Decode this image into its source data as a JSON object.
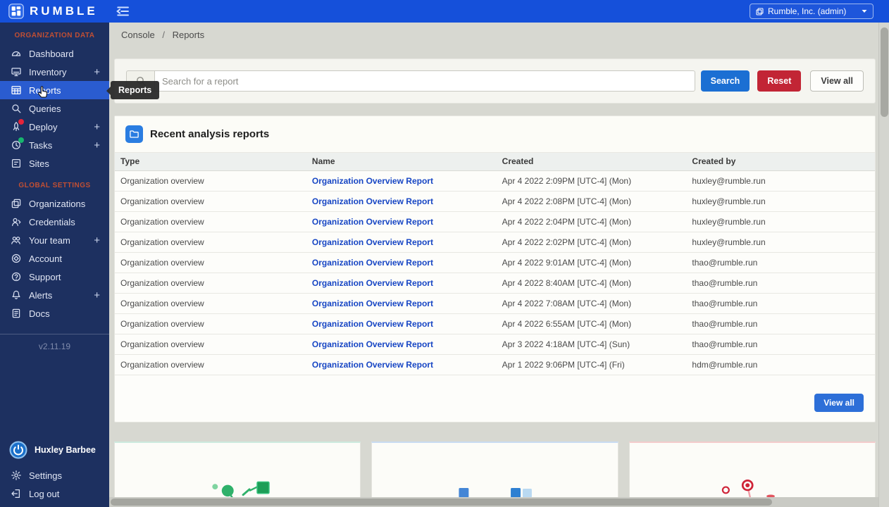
{
  "header": {
    "brand": "RUMBLE",
    "org_selector": "Rumble, Inc. (admin)"
  },
  "breadcrumb": {
    "parent": "Console",
    "separator": "/",
    "current": "Reports"
  },
  "tooltip": {
    "label": "Reports"
  },
  "search_panel": {
    "placeholder": "Search for a report",
    "search_button": "Search",
    "reset_button": "Reset",
    "view_all_button": "View all"
  },
  "sidebar": {
    "sections": [
      {
        "label": "ORGANIZATION DATA",
        "items": [
          {
            "label": "Dashboard",
            "icon": "dashboard"
          },
          {
            "label": "Inventory",
            "icon": "inventory",
            "expandable": true
          },
          {
            "label": "Reports",
            "icon": "reports",
            "selected": true
          },
          {
            "label": "Queries",
            "icon": "queries"
          },
          {
            "label": "Deploy",
            "icon": "deploy",
            "expandable": true,
            "badge": "red"
          },
          {
            "label": "Tasks",
            "icon": "tasks",
            "expandable": true,
            "badge": "green"
          },
          {
            "label": "Sites",
            "icon": "sites"
          }
        ]
      },
      {
        "label": "GLOBAL SETTINGS",
        "items": [
          {
            "label": "Organizations",
            "icon": "organizations"
          },
          {
            "label": "Credentials",
            "icon": "credentials"
          },
          {
            "label": "Your team",
            "icon": "team",
            "expandable": true
          },
          {
            "label": "Account",
            "icon": "account"
          },
          {
            "label": "Support",
            "icon": "support"
          },
          {
            "label": "Alerts",
            "icon": "alerts",
            "expandable": true
          },
          {
            "label": "Docs",
            "icon": "docs"
          }
        ]
      }
    ],
    "version": "v2.11.19",
    "user_name": "Huxley Barbee",
    "footer_items": [
      {
        "label": "Settings",
        "icon": "gear"
      },
      {
        "label": "Log out",
        "icon": "logout"
      }
    ]
  },
  "reports_table": {
    "title": "Recent analysis reports",
    "columns": [
      "Type",
      "Name",
      "Created",
      "Created by"
    ],
    "rows": [
      {
        "type": "Organization overview",
        "name": "Organization Overview Report",
        "created": "Apr 4 2022 2:09PM [UTC-4] (Mon)",
        "created_by": "huxley@rumble.run"
      },
      {
        "type": "Organization overview",
        "name": "Organization Overview Report",
        "created": "Apr 4 2022 2:08PM [UTC-4] (Mon)",
        "created_by": "huxley@rumble.run"
      },
      {
        "type": "Organization overview",
        "name": "Organization Overview Report",
        "created": "Apr 4 2022 2:04PM [UTC-4] (Mon)",
        "created_by": "huxley@rumble.run"
      },
      {
        "type": "Organization overview",
        "name": "Organization Overview Report",
        "created": "Apr 4 2022 2:02PM [UTC-4] (Mon)",
        "created_by": "huxley@rumble.run"
      },
      {
        "type": "Organization overview",
        "name": "Organization Overview Report",
        "created": "Apr 4 2022 9:01AM [UTC-4] (Mon)",
        "created_by": "thao@rumble.run"
      },
      {
        "type": "Organization overview",
        "name": "Organization Overview Report",
        "created": "Apr 4 2022 8:40AM [UTC-4] (Mon)",
        "created_by": "thao@rumble.run"
      },
      {
        "type": "Organization overview",
        "name": "Organization Overview Report",
        "created": "Apr 4 2022 7:08AM [UTC-4] (Mon)",
        "created_by": "thao@rumble.run"
      },
      {
        "type": "Organization overview",
        "name": "Organization Overview Report",
        "created": "Apr 4 2022 6:55AM [UTC-4] (Mon)",
        "created_by": "thao@rumble.run"
      },
      {
        "type": "Organization overview",
        "name": "Organization Overview Report",
        "created": "Apr 3 2022 4:18AM [UTC-4] (Sun)",
        "created_by": "thao@rumble.run"
      },
      {
        "type": "Organization overview",
        "name": "Organization Overview Report",
        "created": "Apr 1 2022 9:06PM [UTC-4] (Fri)",
        "created_by": "hdm@rumble.run"
      }
    ],
    "view_all_button": "View all"
  },
  "preview_cards": [
    {
      "name": "green-report-preview",
      "accent": "#2fb16a"
    },
    {
      "name": "blue-report-preview",
      "accent": "#2e80d2"
    },
    {
      "name": "red-report-preview",
      "accent": "#cf2438"
    }
  ],
  "colors": {
    "topbar_blue": "#1550da",
    "sidebar_navy": "#1d3060",
    "selected_item_blue": "#2a5cd0",
    "section_label_orange": "#c14f33",
    "link_blue": "#1746c4",
    "search_button_blue": "#1b6fd3",
    "reset_button_red": "#c22535",
    "view_all_button_blue": "#2d6fd8"
  }
}
